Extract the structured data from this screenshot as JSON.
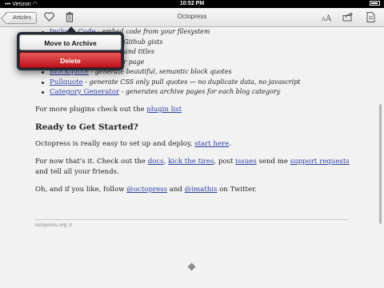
{
  "status_bar": {
    "carrier": "Verizon",
    "time": "10:52 PM"
  },
  "toolbar": {
    "back_label": "Articles",
    "title": "Octopress"
  },
  "popover": {
    "archive_label": "Move to Archive",
    "delete_label": "Delete"
  },
  "content": {
    "plugins": [
      {
        "link": "Include Code",
        "desc": " - embed code from your filesystem"
      },
      {
        "link": "",
        "desc": "ownloads and embeds Github gists"
      },
      {
        "link": "",
        "desc": "ages with class names and titles"
      },
      {
        "link": "",
        "desc": "file into another post or page"
      },
      {
        "link": "Blockquote",
        "desc": " - generate beautiful, semantic block quotes"
      },
      {
        "link": "Pullquote",
        "desc": " - generate CSS only pull quotes — no duplicate data, no javascript"
      },
      {
        "link": "Category Generator",
        "desc": " - generates archive pages for each blog category"
      }
    ],
    "more_plugins_prefix": "For more plugins check out the ",
    "plugin_list_link": "plugin list",
    "heading": "Ready to Get Started?",
    "easy_setup": "Octopress is really easy to set up and deploy, ",
    "start_here_link": "start here",
    "period": ".",
    "closing_prefix": "For now that's it. Check out the ",
    "docs_link": "docs",
    "comma1": ", ",
    "kick_tires_link": "kick the tires",
    "post_text": ", post ",
    "issues_link": "issues",
    "send_me_text": " send me ",
    "support_link": "support requests",
    "tell_friends": " and tell all your friends.",
    "follow_prefix": "Oh, and if you like, follow ",
    "octopress_handle": "@octopress",
    "and_text": " and ",
    "imathis_handle": "@imathis",
    "on_twitter": " on Twitter.",
    "footer_source": "octopress.org"
  }
}
